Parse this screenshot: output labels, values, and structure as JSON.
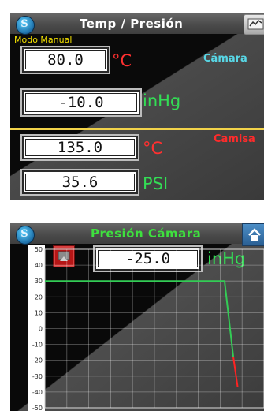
{
  "panel1": {
    "title": "Temp / Presión",
    "mode_label": "Modo Manual",
    "chamber_label": "Cámara",
    "jacket_label": "Camisa",
    "chamber_temp": {
      "value": "80.0",
      "unit": "°C"
    },
    "chamber_pressure": {
      "value": "-10.0",
      "unit": "inHg"
    },
    "jacket_temp": {
      "value": "135.0",
      "unit": "°C"
    },
    "jacket_pressure": {
      "value": "35.6",
      "unit": "PSI"
    },
    "icons": {
      "logo": "logo-s-icon",
      "graph_button": "graph-icon"
    }
  },
  "panel2": {
    "title": "Presión Cámara",
    "pressure": {
      "value": "-25.0",
      "unit": "inHg"
    },
    "icons": {
      "logo": "logo-s-icon",
      "alarm": "alarm-icon",
      "home": "home-icon"
    }
  },
  "colors": {
    "title_white": "#ffffff",
    "title_green": "#3ee03e",
    "yellow": "#f3e000",
    "red": "#ff2b2b",
    "cyan": "#58d7e6",
    "green": "#33dd55"
  },
  "chart_data": {
    "type": "line",
    "ylim": [
      -50,
      50
    ],
    "yticks": [
      "50",
      "40",
      "30",
      "20",
      "10",
      "0",
      "-10",
      "-20",
      "-30",
      "-40",
      "-50"
    ],
    "grid": true,
    "series": [
      {
        "color": "#33cc55",
        "values": [
          [
            0,
            30
          ],
          [
            0.82,
            30
          ],
          [
            0.86,
            -18
          ]
        ]
      },
      {
        "color": "#ff2222",
        "values": [
          [
            0.86,
            -18
          ],
          [
            0.88,
            -37
          ]
        ]
      }
    ]
  }
}
